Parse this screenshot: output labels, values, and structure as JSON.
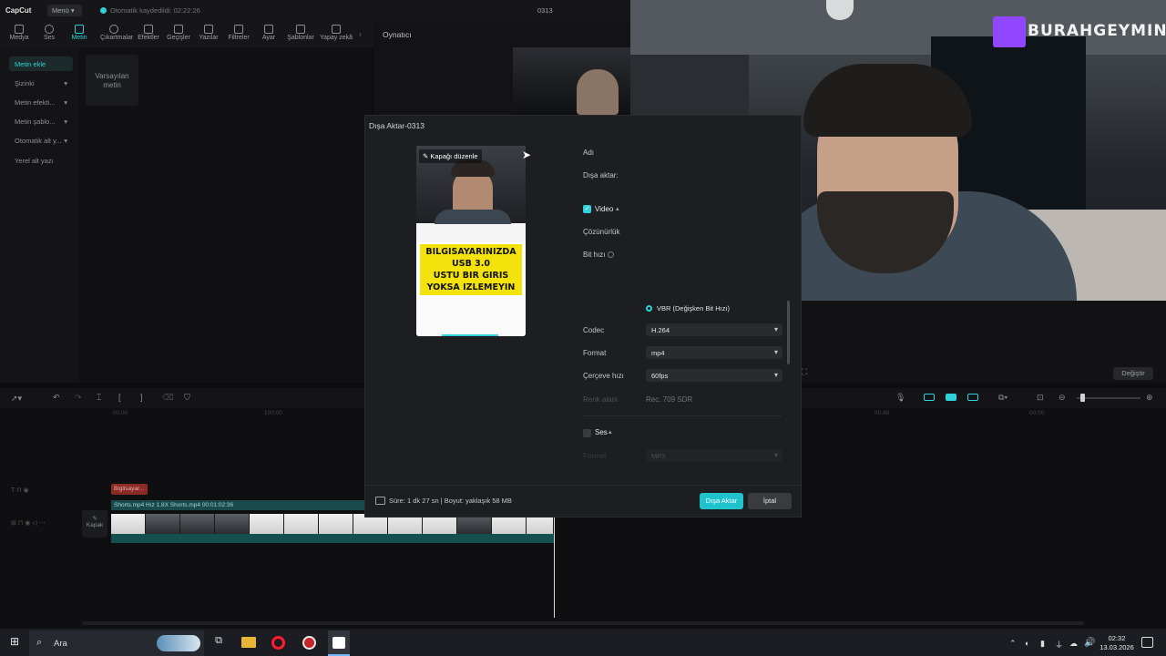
{
  "app": {
    "logo": "CapCut",
    "menu": "Menü",
    "autosave": "Otomatik kaydedildi: 02:22:26",
    "project_title": "0313"
  },
  "toolbar": {
    "items": [
      {
        "label": "Medya",
        "icon": "media-icon"
      },
      {
        "label": "Ses",
        "icon": "audio-icon"
      },
      {
        "label": "Metin",
        "icon": "text-icon",
        "active": true
      },
      {
        "label": "Çıkartmalar",
        "icon": "sticker-icon"
      },
      {
        "label": "Efektler",
        "icon": "effects-icon"
      },
      {
        "label": "Geçişler",
        "icon": "transitions-icon"
      },
      {
        "label": "Yazılar",
        "icon": "captions-icon"
      },
      {
        "label": "Filtreler",
        "icon": "filters-icon"
      },
      {
        "label": "Ayar",
        "icon": "adjust-icon"
      },
      {
        "label": "Şablonlar",
        "icon": "templates-icon"
      },
      {
        "label": "Yapay zekâ",
        "icon": "ai-icon"
      }
    ]
  },
  "left_panel": {
    "items": [
      "Metin ekle",
      "Şizinki",
      "Metin efekti...",
      "Metin şablo...",
      "Otomatik alt y...",
      "Yerel alt yazı"
    ]
  },
  "mid_panel": {
    "default_text": "Varsayılan metin"
  },
  "player": {
    "label": "Oynatıcı",
    "change": "Değiştir"
  },
  "webcam": {
    "watermark": "BURAHGEYMING"
  },
  "dialog": {
    "title": "Dışa Aktar-0313",
    "edit_cover": "Kapağı düzenle",
    "thumbnail_text": [
      "BILGISAYARINIZDA",
      "USB 3.0",
      "USTU BIR GIRIS",
      "YOKSA IZLEMEYIN"
    ],
    "fields": {
      "name": "Adı",
      "export_to": "Dışa aktar:",
      "video": "Video",
      "resolution": "Çözünürlük",
      "bitrate": "Bit hızı",
      "vbr": "VBR (Değişken Bit Hızı)",
      "codec": "Codec",
      "codec_value": "H.264",
      "format": "Format",
      "format_value": "mp4",
      "framerate": "Çerçeve hızı",
      "framerate_value": "60fps",
      "color_space": "Renk alanı",
      "color_space_value": "Rec. 709 SDR",
      "audio": "Ses",
      "audio_format_label": "Format",
      "audio_format_value": "MP3"
    },
    "footer_info": "Süre: 1 dk 27 sn | Boyut: yaklaşık 58 MB",
    "export_button": "Dışa Aktar",
    "cancel_button": "İptal"
  },
  "timeline": {
    "ticks": [
      "00:00",
      "100:00",
      "100:00",
      "00:40",
      "00:00"
    ],
    "track_label": "Biglisayar...",
    "clip_label": "Shorts.mp4  Hız 1.8X  Shorts.mp4  00:01:02:36",
    "cover_label": "Kapak"
  },
  "taskbar": {
    "search": "Ara",
    "time": "02:32",
    "date": "13.03.2026"
  }
}
